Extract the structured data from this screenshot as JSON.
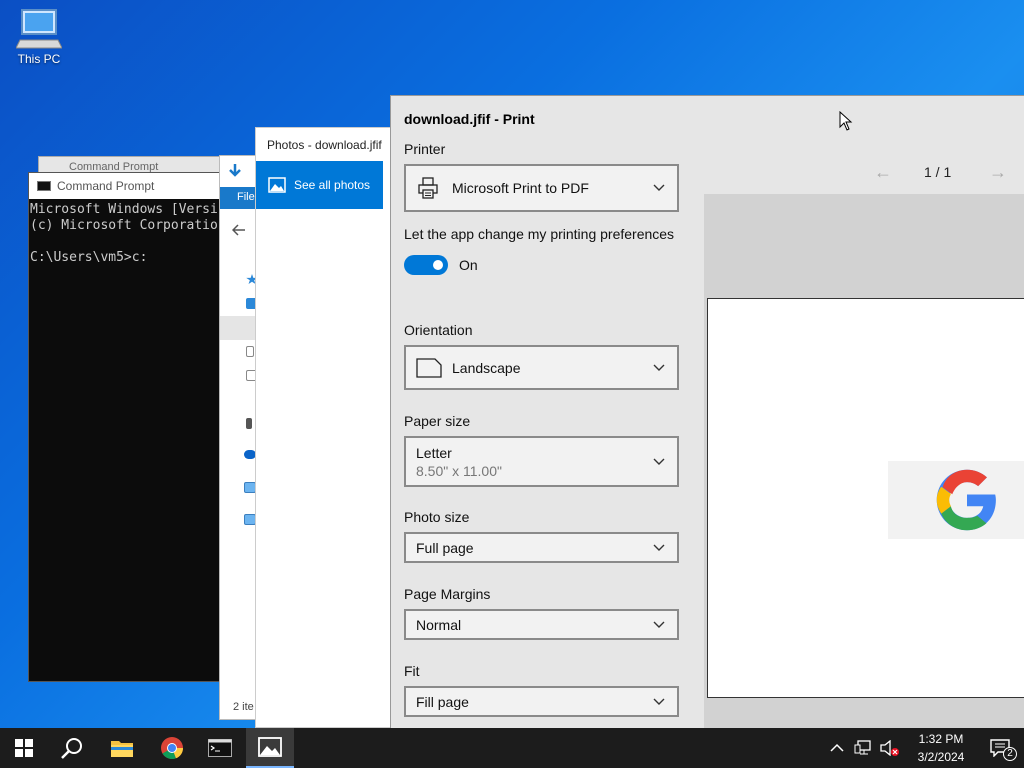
{
  "desktop": {
    "this_pc_label": "This PC"
  },
  "cmd": {
    "title": "Command Prompt",
    "back_title": "Command Prompt",
    "lines": "Microsoft Windows [Versi\n(c) Microsoft Corporatio\n\nC:\\Users\\vm5>c:"
  },
  "explorer": {
    "ribbon_tab": "File",
    "status": "2 ite"
  },
  "photos": {
    "title": "Photos - download.jfif",
    "see_all": "See all photos"
  },
  "print": {
    "title": "download.jfif - Print",
    "printer_label": "Printer",
    "printer_value": "Microsoft Print to PDF",
    "pref_label": "Let the app change my printing preferences",
    "toggle_state": "On",
    "orientation_label": "Orientation",
    "orientation_value": "Landscape",
    "paper_label": "Paper size",
    "paper_value": "Letter",
    "paper_dims": "8.50\" x 11.00\"",
    "photo_label": "Photo size",
    "photo_value": "Full page",
    "margins_label": "Page Margins",
    "margins_value": "Normal",
    "fit_label": "Fit",
    "fit_value": "Fill page",
    "page_counter": "1  /  1"
  },
  "taskbar": {
    "time": "1:32 PM",
    "date": "3/2/2024",
    "notification_count": "2"
  },
  "colors": {
    "accent": "#0078d7",
    "taskbar": "#1c1c1c"
  }
}
